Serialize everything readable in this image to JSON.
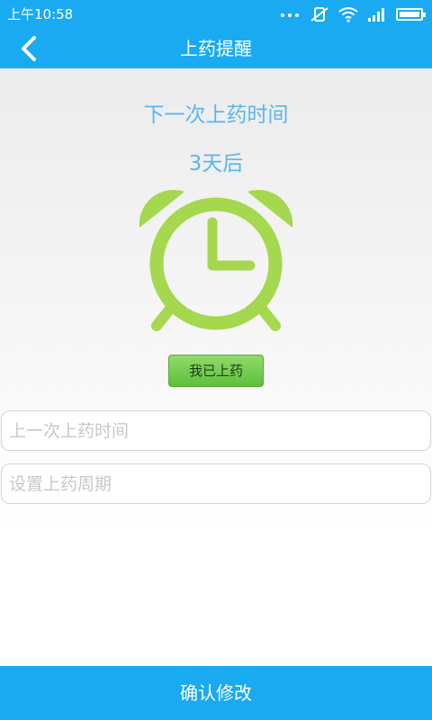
{
  "status_bar": {
    "time": "上午10:58"
  },
  "nav": {
    "title": "上药提醒"
  },
  "reminder": {
    "label": "下一次上药时间",
    "value": "3天后"
  },
  "actions": {
    "done_label": "我已上药",
    "confirm_label": "确认修改"
  },
  "fields": {
    "last_time_placeholder": "上一次上药时间",
    "cycle_placeholder": "设置上药周期"
  },
  "colors": {
    "primary": "#19aaf1",
    "accent_text": "#5ab6ee",
    "clock_green": "#a5d84e",
    "button_green": "#6cc846"
  }
}
